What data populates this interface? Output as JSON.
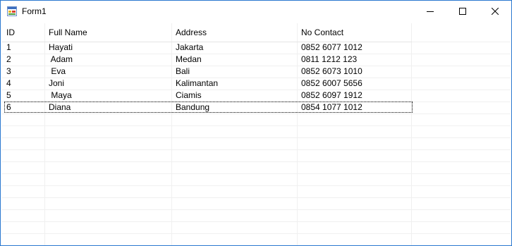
{
  "window": {
    "title": "Form1",
    "icon": "winforms-app-icon",
    "controls": [
      "minimize-icon",
      "maximize-icon",
      "close-icon"
    ]
  },
  "grid": {
    "columns": [
      "ID",
      "Full Name",
      "Address",
      "No Contact"
    ],
    "rows": [
      [
        "1",
        "Hayati",
        "Jakarta",
        "0852 6077 1012"
      ],
      [
        "2",
        " Adam",
        "Medan",
        "0811 1212 123"
      ],
      [
        "3",
        " Eva",
        "Bali",
        "0852 6073 1010"
      ],
      [
        "4",
        "Joni",
        "Kalimantan",
        "0852 6007 5656"
      ],
      [
        "5",
        " Maya",
        "Ciamis",
        "0852 6097 1912"
      ],
      [
        "6",
        "Diana",
        "Bandung",
        "0854 1077 1012"
      ]
    ],
    "focused_row": 6,
    "colors": {
      "window_border": "#2b79d0",
      "gridline": "#f0f0f0"
    }
  }
}
